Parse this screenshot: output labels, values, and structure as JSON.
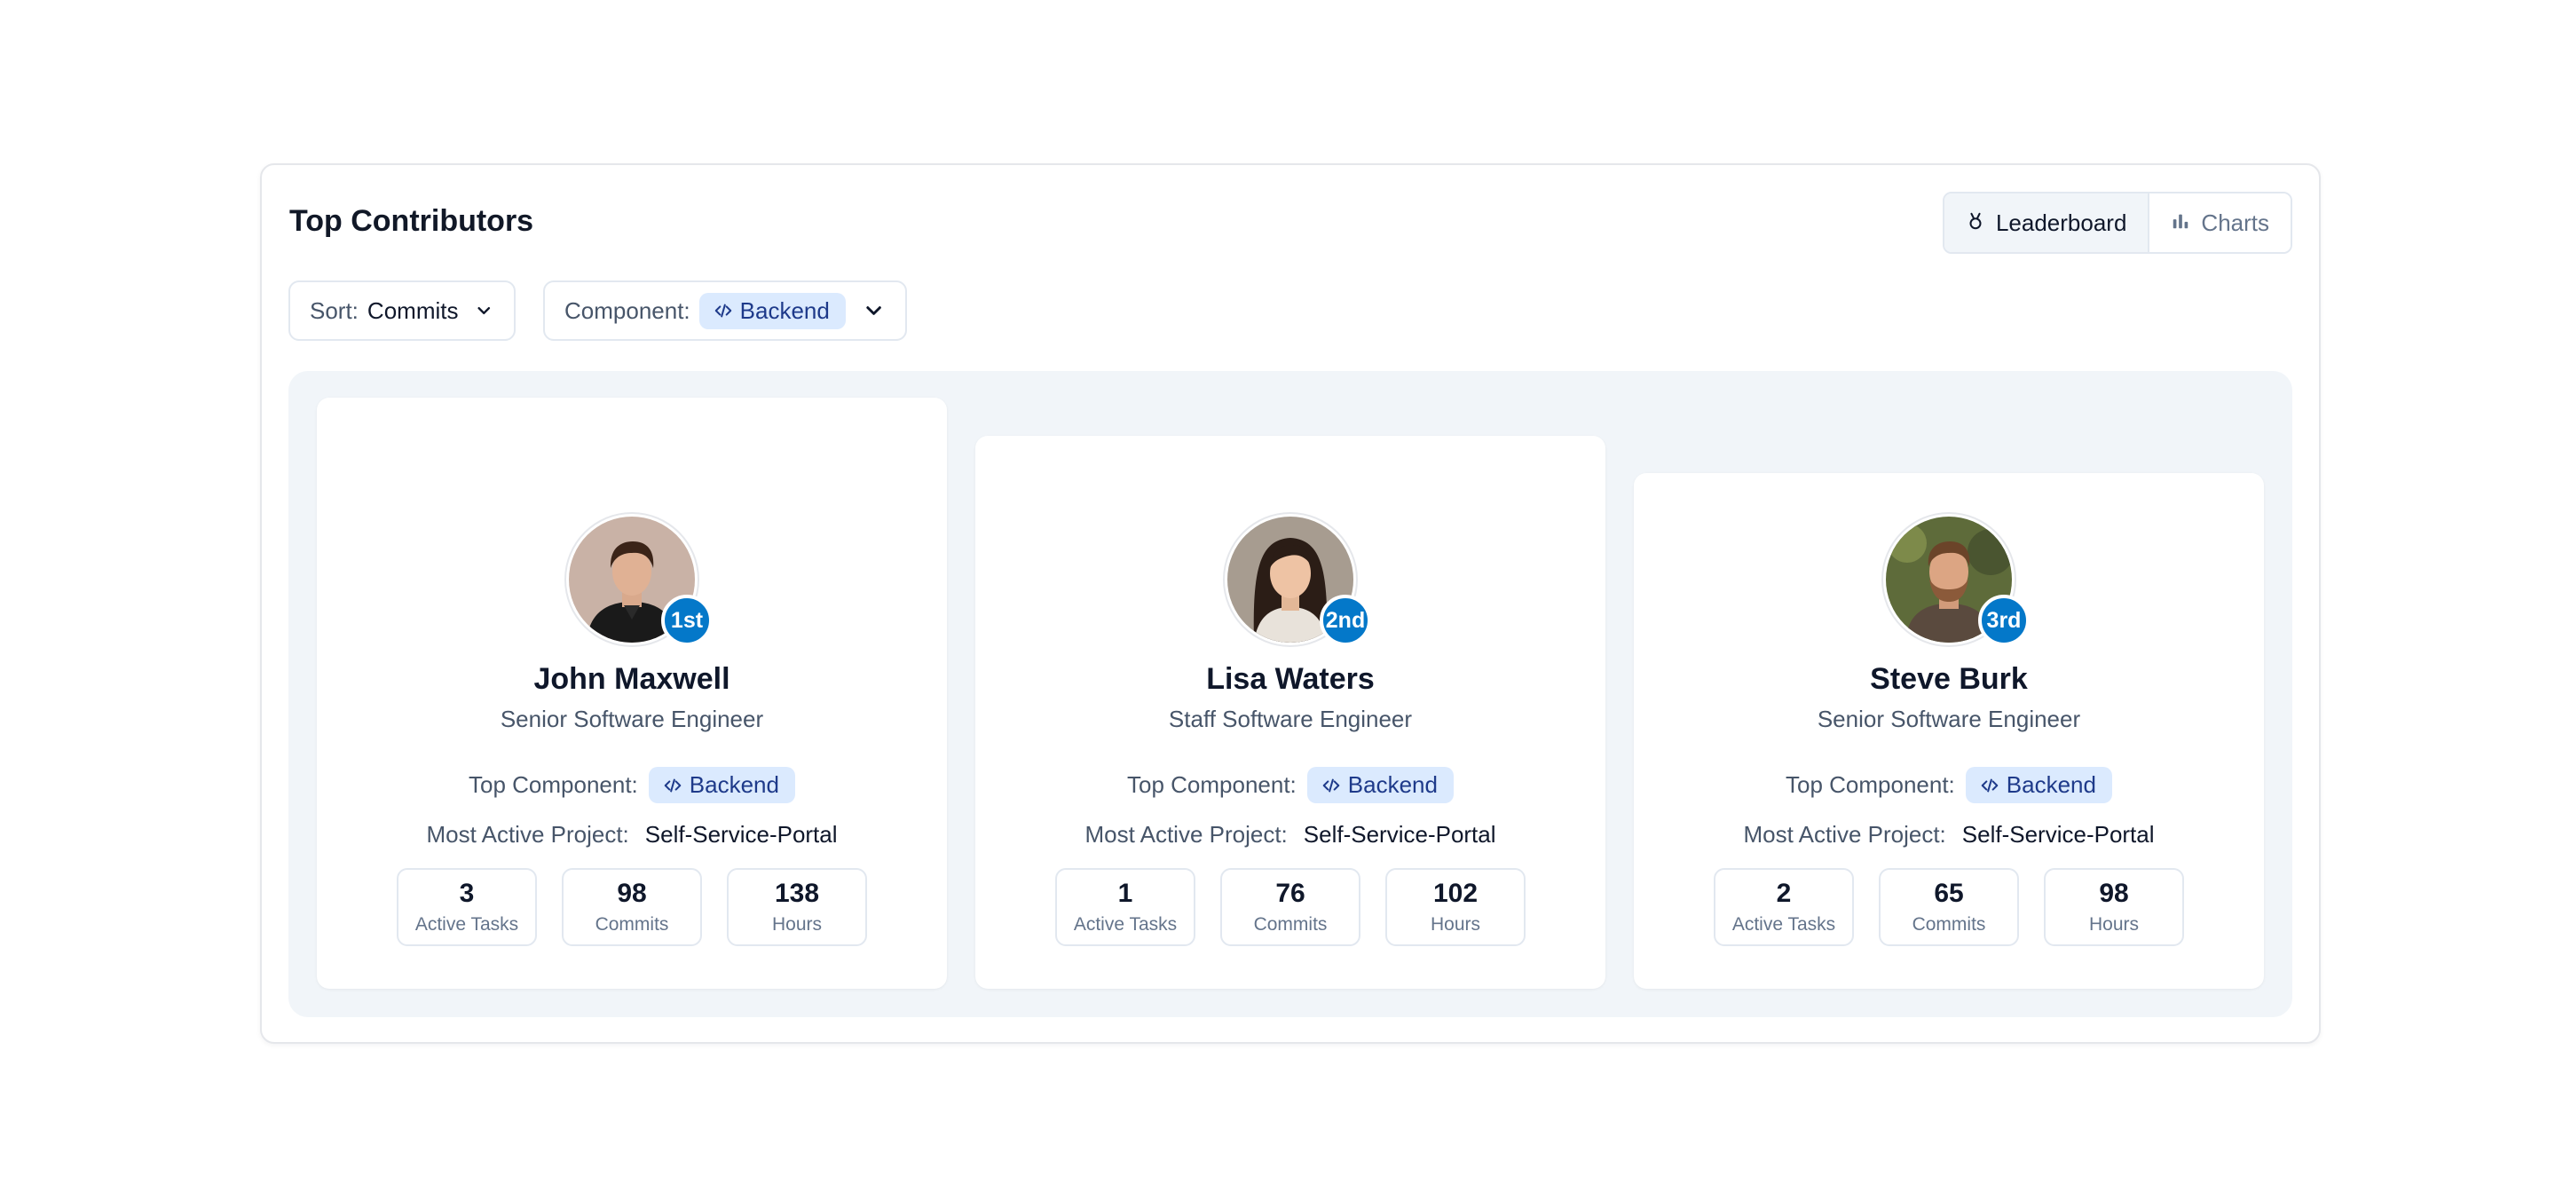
{
  "panel": {
    "title": "Top Contributors",
    "views": [
      {
        "label": "Leaderboard",
        "icon": "medal-icon",
        "active": true
      },
      {
        "label": "Charts",
        "icon": "bar-chart-icon",
        "active": false
      }
    ]
  },
  "filters": {
    "sort": {
      "label": "Sort:",
      "value": "Commits"
    },
    "component": {
      "label": "Component:",
      "value": "Backend",
      "icon": "code-icon"
    }
  },
  "labels": {
    "top_component": "Top Component:",
    "most_active_project": "Most Active Project:",
    "active_tasks": "Active Tasks",
    "commits": "Commits",
    "hours": "Hours"
  },
  "contributors": [
    {
      "rank": "1st",
      "name": "John Maxwell",
      "role": "Senior Software Engineer",
      "component": "Backend",
      "project": "Self-Service-Portal",
      "active_tasks": "3",
      "commits": "98",
      "hours": "138"
    },
    {
      "rank": "2nd",
      "name": "Lisa Waters",
      "role": "Staff Software Engineer",
      "component": "Backend",
      "project": "Self-Service-Portal",
      "active_tasks": "1",
      "commits": "76",
      "hours": "102"
    },
    {
      "rank": "3rd",
      "name": "Steve Burk",
      "role": "Senior Software Engineer",
      "component": "Backend",
      "project": "Self-Service-Portal",
      "active_tasks": "2",
      "commits": "65",
      "hours": "98"
    }
  ],
  "colors": {
    "accent": "#0478c9",
    "tag_bg": "#dbeafe",
    "tag_text": "#1e3a8a",
    "board_bg": "#f1f5f9"
  }
}
